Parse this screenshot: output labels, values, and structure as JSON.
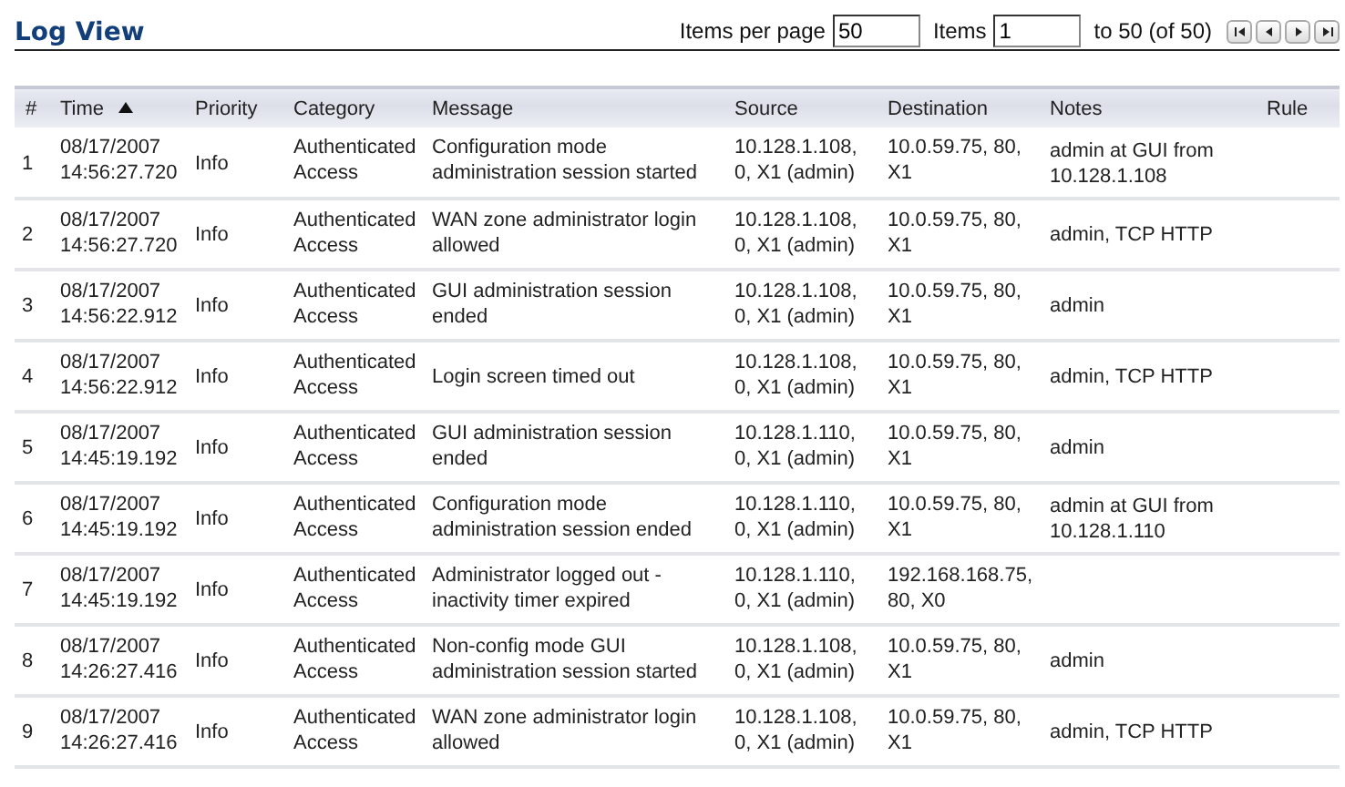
{
  "title": "Log View",
  "pager": {
    "per_page_label": "Items per page",
    "per_page": "50",
    "items_label": "Items",
    "start": "1",
    "range": "to 50 (of 50)"
  },
  "table": {
    "columns": [
      {
        "label": "#",
        "sorted": false
      },
      {
        "label": "Time",
        "sorted": true
      },
      {
        "label": "Priority",
        "sorted": false
      },
      {
        "label": "Category",
        "sorted": false
      },
      {
        "label": "Message",
        "sorted": false
      },
      {
        "label": "Source",
        "sorted": false
      },
      {
        "label": "Destination",
        "sorted": false
      },
      {
        "label": "Notes",
        "sorted": false
      },
      {
        "label": "Rule",
        "sorted": false
      }
    ],
    "rows": [
      [
        "1",
        "08/17/2007 14:56:27.720",
        "Info",
        "Authenticated Access",
        "Configuration mode administration session started",
        "10.128.1.108, 0, X1 (admin)",
        "10.0.59.75, 80, X1",
        "admin at GUI from 10.128.1.108"
      ],
      [
        "2",
        "08/17/2007 14:56:27.720",
        "Info",
        "Authenticated Access",
        "WAN zone administrator login allowed",
        "10.128.1.108, 0, X1 (admin)",
        "10.0.59.75, 80, X1",
        "admin, TCP HTTP"
      ],
      [
        "3",
        "08/17/2007 14:56:22.912",
        "Info",
        "Authenticated Access",
        "GUI administration session ended",
        "10.128.1.108, 0, X1 (admin)",
        "10.0.59.75, 80, X1",
        "admin"
      ],
      [
        "4",
        "08/17/2007 14:56:22.912",
        "Info",
        "Authenticated Access",
        "Login screen timed out",
        "10.128.1.108, 0, X1 (admin)",
        "10.0.59.75, 80, X1",
        "admin, TCP HTTP"
      ],
      [
        "5",
        "08/17/2007 14:45:19.192",
        "Info",
        "Authenticated Access",
        "GUI administration session ended",
        "10.128.1.110, 0, X1 (admin)",
        "10.0.59.75, 80, X1",
        "admin"
      ],
      [
        "6",
        "08/17/2007 14:45:19.192",
        "Info",
        "Authenticated Access",
        "Configuration mode administration session ended",
        "10.128.1.110, 0, X1 (admin)",
        "10.0.59.75, 80, X1",
        "admin at GUI from 10.128.1.110"
      ],
      [
        "7",
        "08/17/2007 14:45:19.192",
        "Info",
        "Authenticated Access",
        "Administrator logged out - inactivity timer expired",
        "10.128.1.110, 0, X1 (admin)",
        "192.168.168.75, 80, X0",
        ""
      ],
      [
        "8",
        "08/17/2007 14:26:27.416",
        "Info",
        "Authenticated Access",
        "Non-config mode GUI administration session started",
        "10.128.1.108, 0, X1 (admin)",
        "10.0.59.75, 80, X1",
        "admin"
      ],
      [
        "9",
        "08/17/2007 14:26:27.416",
        "Info",
        "Authenticated Access",
        "WAN zone administrator login allowed",
        "10.128.1.108, 0, X1 (admin)",
        "10.0.59.75, 80, X1",
        "admin, TCP HTTP"
      ]
    ]
  }
}
